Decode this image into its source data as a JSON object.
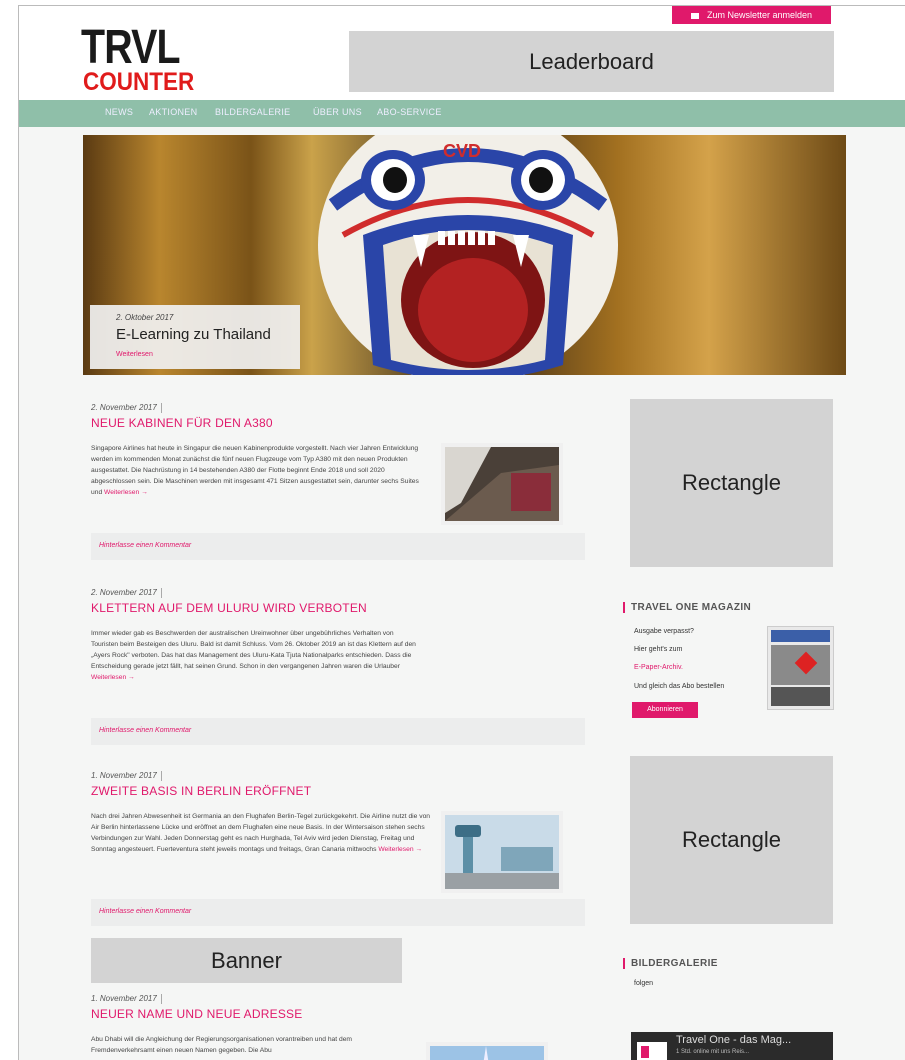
{
  "brand": {
    "logo_line1": "TRVL",
    "logo_line2": "COUNTER",
    "accent": "#e0196b",
    "nav_color": "#8fbfa9"
  },
  "header": {
    "newsletter_label": "Zum Newsletter anmelden",
    "leaderboard_label": "Leaderboard"
  },
  "nav": {
    "items": [
      "NEWS",
      "AKTIONEN",
      "BILDERGALERIE",
      "ÜBER UNS",
      "ABO-SERVICE"
    ]
  },
  "hero": {
    "date": "2. Oktober 2017",
    "title": "E-Learning zu Thailand",
    "more": "Weiterlesen"
  },
  "posts": [
    {
      "date": "2. November 2017",
      "title": "NEUE KABINEN FÜR DEN A380",
      "text": "Singapore Airlines hat heute in Singapur die neuen Kabinenprodukte vorgestellt. Nach vier Jahren Entwicklung werden im kommenden Monat zunächst die fünf neuen Flugzeuge vom Typ A380 mit den neuen Produkten ausgestattet. Die Nachrüstung in 14 bestehenden A380 der Flotte beginnt Ende 2018 und soll 2020 abgeschlossen sein. Die Maschinen werden mit insgesamt 471 Sitzen ausgestattet sein, darunter sechs Suites und",
      "more": "Weiterlesen →",
      "comment": "Hinterlasse einen Kommentar"
    },
    {
      "date": "2. November 2017",
      "title": "KLETTERN AUF DEM ULURU WIRD VERBOTEN",
      "text": "Immer wieder gab es Beschwerden der australischen Ureinwohner über ungebührliches Verhalten von Touristen beim Besteigen des Uluru. Bald ist damit Schluss. Vom 26. Oktober 2019 an ist das Klettern auf den „Ayers Rock\" verboten. Das hat das Management des Uluru-Kata Tjuta Nationalparks entschieden. Dass die Entscheidung gerade jetzt fällt, hat seinen Grund. Schon in den vergangenen Jahren waren die Urlauber",
      "more": "Weiterlesen →",
      "comment": "Hinterlasse einen Kommentar"
    },
    {
      "date": "1. November 2017",
      "title": "ZWEITE BASIS IN BERLIN ERÖFFNET",
      "text": "Nach drei Jahren Abwesenheit ist Germania an den Flughafen Berlin-Tegel zurückgekehrt. Die Airline nutzt die von Air Berlin hinterlassene Lücke und eröffnet an dem Flughafen eine neue Basis. In der Wintersaison stehen sechs Verbindungen zur Wahl. Jeden Donnerstag geht es nach Hurghada, Tel Aviv wird jeden Dienstag, Freitag und Sonntag angesteuert. Fuerteventura steht jeweils montags und freitags, Gran Canaria mittwochs",
      "more": "Weiterlesen →",
      "comment": "Hinterlasse einen Kommentar"
    },
    {
      "date": "1. November 2017",
      "title": "NEUER NAME UND NEUE ADRESSE",
      "text": "Abu Dhabi will die Angleichung der Regierungsorganisationen vorantreiben und hat dem Fremdenverkehrsamt einen neuen Namen gegeben. Die Abu"
    }
  ],
  "sidebar": {
    "rect1": "Rectangle",
    "rect2": "Rectangle",
    "magazine_title": "TRAVEL ONE MAGAZIN",
    "magazine_lines": [
      "Ausgabe verpasst?",
      "Hier geht's zum",
      "E-Paper-Archiv.",
      "Und gleich das Abo bestellen"
    ],
    "abo_button": "Abonnieren",
    "gallery_title": "BILDERGALERIE",
    "gallery_text": "folgen",
    "video_title": "Travel One - das Mag...",
    "video_sub": "1 Std. online mit uns Reis..."
  },
  "banner_label": "Banner"
}
